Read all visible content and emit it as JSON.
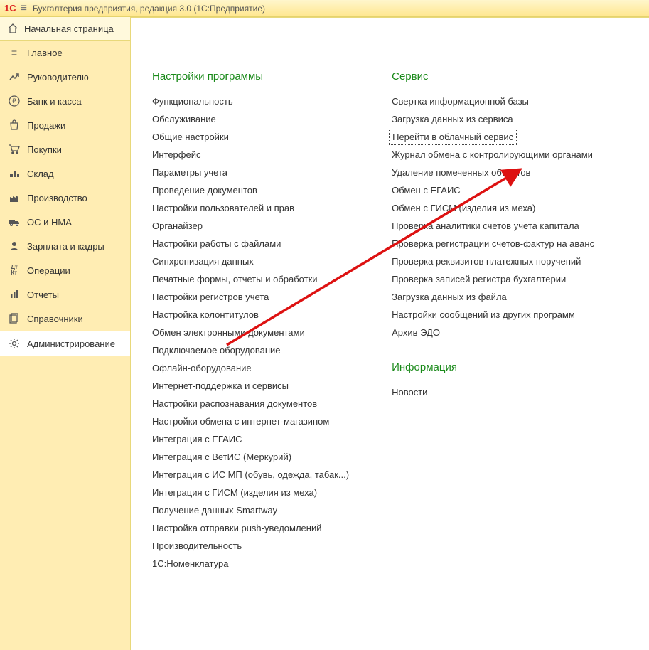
{
  "titlebar": {
    "logo": "1С",
    "title": "Бухгалтерия предприятия, редакция 3.0  (1С:Предприятие)"
  },
  "sidebar": {
    "start_page": "Начальная страница",
    "items": [
      {
        "icon": "menu-icon",
        "label": "Главное"
      },
      {
        "icon": "trend-icon",
        "label": "Руководителю"
      },
      {
        "icon": "ruble-icon",
        "label": "Банк и касса"
      },
      {
        "icon": "bag-icon",
        "label": "Продажи"
      },
      {
        "icon": "cart-icon",
        "label": "Покупки"
      },
      {
        "icon": "warehouse-icon",
        "label": "Склад"
      },
      {
        "icon": "factory-icon",
        "label": "Производство"
      },
      {
        "icon": "truck-icon",
        "label": "ОС и НМА"
      },
      {
        "icon": "person-icon",
        "label": "Зарплата и кадры"
      },
      {
        "icon": "dtkt-icon",
        "label": "Операции"
      },
      {
        "icon": "chart-icon",
        "label": "Отчеты"
      },
      {
        "icon": "books-icon",
        "label": "Справочники"
      },
      {
        "icon": "gear-icon",
        "label": "Администрирование"
      }
    ],
    "active_index": 12
  },
  "content": {
    "sections": [
      {
        "title": "Настройки программы",
        "links": [
          "Функциональность",
          "Обслуживание",
          "Общие настройки",
          "Интерфейс",
          "Параметры учета",
          "Проведение документов",
          "Настройки пользователей и прав",
          "Органайзер",
          "Настройки работы с файлами",
          "Синхронизация данных",
          "Печатные формы, отчеты и обработки",
          "Настройки регистров учета",
          "Настройка колонтитулов",
          "Обмен электронными документами",
          "Подключаемое оборудование",
          "Офлайн-оборудование",
          "Интернет-поддержка и сервисы",
          "Настройки распознавания документов",
          "Настройки обмена с интернет-магазином",
          "Интеграция с ЕГАИС",
          "Интеграция с ВетИС (Меркурий)",
          "Интеграция с ИС МП (обувь, одежда, табак...)",
          "Интеграция с ГИСМ (изделия из меха)",
          "Получение данных Smartway",
          "Настройка отправки push-уведомлений",
          "Производительность",
          "1С:Номенклатура"
        ]
      },
      {
        "title": "Сервис",
        "links": [
          "Свертка информационной базы",
          "Загрузка данных из сервиса",
          "Перейти в облачный сервис",
          "Журнал обмена с контролирующими органами",
          "Удаление помеченных объектов",
          "Обмен с ЕГАИС",
          "Обмен с ГИСМ (изделия из меха)",
          "Проверка аналитики счетов учета капитала",
          "Проверка регистрации счетов-фактур на аванс",
          "Проверка реквизитов платежных поручений",
          "Проверка записей регистра бухгалтерии",
          "Загрузка данных из файла",
          "Настройки сообщений из других программ",
          "Архив ЭДО"
        ],
        "highlighted_index": 2
      },
      {
        "title": "Информация",
        "links": [
          "Новости"
        ]
      }
    ]
  }
}
